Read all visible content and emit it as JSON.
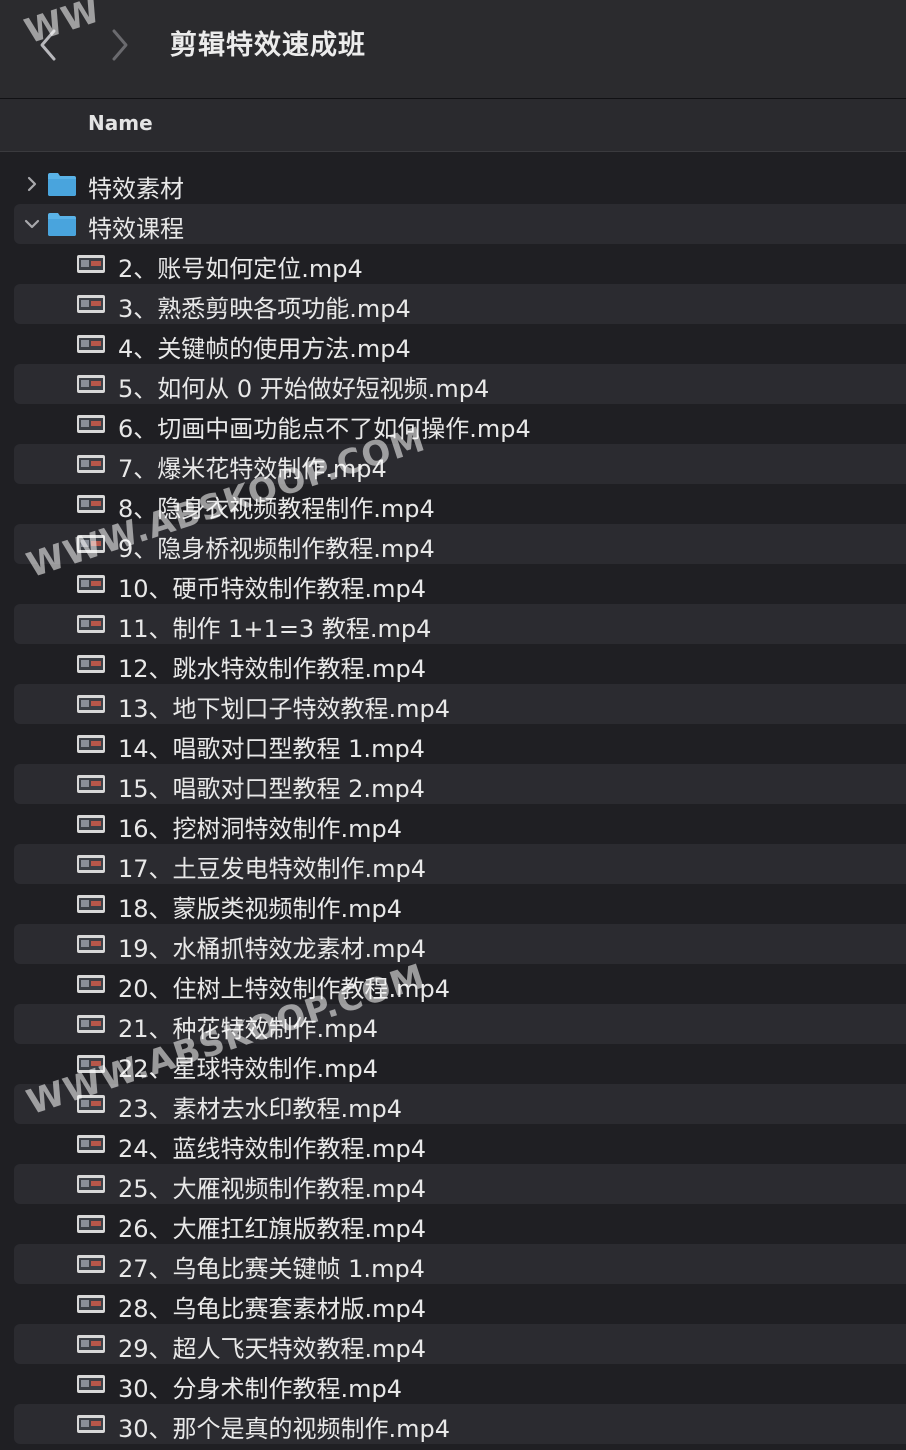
{
  "window": {
    "title": "剪辑特效速成班"
  },
  "nav": {
    "back_icon": "chevron-left-icon",
    "forward_icon": "chevron-right-icon"
  },
  "columns": {
    "name": "Name"
  },
  "colors": {
    "folder": "#5ab3e8",
    "background": "#1f1f23",
    "stripe": "#2b2b30"
  },
  "items": [
    {
      "type": "folder",
      "label": "特效素材",
      "expanded": false
    },
    {
      "type": "folder",
      "label": "特效课程",
      "expanded": true
    },
    {
      "type": "file",
      "label": "2、账号如何定位.mp4"
    },
    {
      "type": "file",
      "label": "3、熟悉剪映各项功能.mp4"
    },
    {
      "type": "file",
      "label": "4、关键帧的使用方法.mp4"
    },
    {
      "type": "file",
      "label": "5、如何从 0 开始做好短视频.mp4"
    },
    {
      "type": "file",
      "label": "6、切画中画功能点不了如何操作.mp4"
    },
    {
      "type": "file",
      "label": "7、爆米花特效制作.mp4"
    },
    {
      "type": "file",
      "label": "8、隐身衣视频教程制作.mp4"
    },
    {
      "type": "file",
      "label": "9、隐身桥视频制作教程.mp4"
    },
    {
      "type": "file",
      "label": "10、硬币特效制作教程.mp4"
    },
    {
      "type": "file",
      "label": "11、制作 1+1=3 教程.mp4"
    },
    {
      "type": "file",
      "label": "12、跳水特效制作教程.mp4"
    },
    {
      "type": "file",
      "label": "13、地下划口子特效教程.mp4"
    },
    {
      "type": "file",
      "label": "14、唱歌对口型教程 1.mp4"
    },
    {
      "type": "file",
      "label": "15、唱歌对口型教程 2.mp4"
    },
    {
      "type": "file",
      "label": "16、挖树洞特效制作.mp4"
    },
    {
      "type": "file",
      "label": "17、土豆发电特效制作.mp4"
    },
    {
      "type": "file",
      "label": "18、蒙版类视频制作.mp4"
    },
    {
      "type": "file",
      "label": "19、水桶抓特效龙素材.mp4"
    },
    {
      "type": "file",
      "label": "20、住树上特效制作教程.mp4"
    },
    {
      "type": "file",
      "label": "21、种花特效制作.mp4"
    },
    {
      "type": "file",
      "label": "22、星球特效制作.mp4"
    },
    {
      "type": "file",
      "label": "23、素材去水印教程.mp4"
    },
    {
      "type": "file",
      "label": "24、蓝线特效制作教程.mp4"
    },
    {
      "type": "file",
      "label": "25、大雁视频制作教程.mp4"
    },
    {
      "type": "file",
      "label": "26、大雁扛红旗版教程.mp4"
    },
    {
      "type": "file",
      "label": "27、乌龟比赛关键帧 1.mp4"
    },
    {
      "type": "file",
      "label": "28、乌龟比赛套素材版.mp4"
    },
    {
      "type": "file",
      "label": "29、超人飞天特效教程.mp4"
    },
    {
      "type": "file",
      "label": "30、分身术制作教程.mp4"
    },
    {
      "type": "file",
      "label": "30、那个是真的视频制作.mp4"
    }
  ],
  "watermarks": [
    {
      "text": "WWW.ABSKOOP.COM"
    },
    {
      "text": "WWW.ABSKOOP.COM"
    },
    {
      "text": "WW"
    }
  ]
}
